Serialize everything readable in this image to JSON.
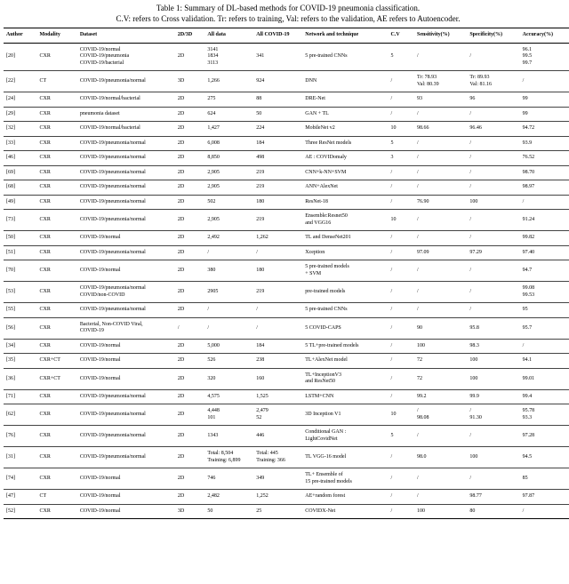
{
  "caption": {
    "line1": "Table 1: Summary of DL-based methods for COVID-19 pneumonia classification.",
    "line2": "C.V: refers to Cross validation. Tr: refers to training, Val: refers to the validation, AE refers to Autoencoder."
  },
  "headers": {
    "author": "Author",
    "modality": "Modality",
    "dataset": "Dataset",
    "dim": "2D/3D",
    "alldata": "All data",
    "allcovid": "All COVID-19",
    "network": "Network and technique",
    "cv": "C.V",
    "sens": "Sensitivity(%)",
    "spec": "Specificity(%)",
    "acc": "Accuracy(%)"
  },
  "rows": [
    {
      "author": "[20]",
      "modality": "CXR",
      "dataset": "COVID-19/normal\nCOVID-19/pneumonia\nCOVID-19/bacterial",
      "dim": "2D",
      "alldata": "3141\n1834\n3113",
      "allcovid": "341",
      "network": "5 pre-trained CNNs",
      "cv": "5",
      "sens": "/",
      "spec": "/",
      "acc": "96.1\n99.5\n99.7"
    },
    {
      "author": "[22]",
      "modality": "CT",
      "dataset": "COVID-19/pneumonia/normal",
      "dim": "3D",
      "alldata": "1,266",
      "allcovid": "924",
      "network": "DNN",
      "cv": "/",
      "sens": "Tr: 78.93\nVal: 80.39",
      "spec": "Tr: 89.93\nVal: 81.16",
      "acc": "/"
    },
    {
      "author": "[24]",
      "modality": "CXR",
      "dataset": "COVID-19/normal/bacterial",
      "dim": "2D",
      "alldata": "275",
      "allcovid": "88",
      "network": "DRE-Net",
      "cv": "/",
      "sens": "93",
      "spec": "96",
      "acc": "99"
    },
    {
      "author": "[29]",
      "modality": "CXR",
      "dataset": "pneumonia dataset",
      "dim": "2D",
      "alldata": "624",
      "allcovid": "50",
      "network": "GAN + TL",
      "cv": "/",
      "sens": "/",
      "spec": "/",
      "acc": "99"
    },
    {
      "author": "[32]",
      "modality": "CXR",
      "dataset": "COVID-19/normal/bacterial",
      "dim": "2D",
      "alldata": "1,427",
      "allcovid": "224",
      "network": "MobileNet v2",
      "cv": "10",
      "sens": "98.66",
      "spec": "96.46",
      "acc": "94.72"
    },
    {
      "author": "[33]",
      "modality": "CXR",
      "dataset": "COVID-19/pneumonia/normal",
      "dim": "2D",
      "alldata": "6,008",
      "allcovid": "184",
      "network": "Three ResNet models",
      "cv": "5",
      "sens": "/",
      "spec": "/",
      "acc": "93.9"
    },
    {
      "author": "[46]",
      "modality": "CXR",
      "dataset": "COVID-19/pneumonia/normal",
      "dim": "2D",
      "alldata": "8,850",
      "allcovid": "498",
      "network": "AE : COVIDomaly",
      "cv": "3",
      "sens": "/",
      "spec": "/",
      "acc": "76.52"
    },
    {
      "author": "[69]",
      "modality": "CXR",
      "dataset": "COVID-19/pneumonia/normal",
      "dim": "2D",
      "alldata": "2,905",
      "allcovid": "219",
      "network": "CNN+k-NN+SVM",
      "cv": "/",
      "sens": "/",
      "spec": "/",
      "acc": "98.70"
    },
    {
      "author": "[68]",
      "modality": "CXR",
      "dataset": "COVID-19/pneumonia/normal",
      "dim": "2D",
      "alldata": "2,905",
      "allcovid": "219",
      "network": "ANN+AlexNet",
      "cv": "/",
      "sens": "/",
      "spec": "/",
      "acc": "98.97"
    },
    {
      "author": "[49]",
      "modality": "CXR",
      "dataset": "COVID-19/pneumonia/normal",
      "dim": "2D",
      "alldata": "502",
      "allcovid": "180",
      "network": "ResNet-18",
      "cv": "/",
      "sens": "76.90",
      "spec": "100",
      "acc": "/"
    },
    {
      "author": "[73]",
      "modality": "CXR",
      "dataset": "COVID-19/pneumonia/normal",
      "dim": "2D",
      "alldata": "2,905",
      "allcovid": "219",
      "network": "Ensemble:Resnet50\nand VGG16",
      "cv": "10",
      "sens": "/",
      "spec": "/",
      "acc": "91.24"
    },
    {
      "author": "[50]",
      "modality": "CXR",
      "dataset": "COVID-19/normal",
      "dim": "2D",
      "alldata": "2,492",
      "allcovid": "1,262",
      "network": "TL and DenseNet201",
      "cv": "/",
      "sens": "/",
      "spec": "/",
      "acc": "99.82"
    },
    {
      "author": "[51]",
      "modality": "CXR",
      "dataset": "COVID-19/pneumonia/normal",
      "dim": "2D",
      "alldata": "/",
      "allcovid": "/",
      "network": "Xception",
      "cv": "/",
      "sens": "97.09",
      "spec": "97.29",
      "acc": "97.40"
    },
    {
      "author": "[70]",
      "modality": "CXR",
      "dataset": "COVID-19/normal",
      "dim": "2D",
      "alldata": "380",
      "allcovid": "180",
      "network": "5 pre-trained models\n+ SVM",
      "cv": "/",
      "sens": "/",
      "spec": "/",
      "acc": "94.7"
    },
    {
      "author": "[53]",
      "modality": "CXR",
      "dataset": "COVID-19/pneumonia/normal\nCOVID/non-COVID",
      "dim": "2D",
      "alldata": "2905",
      "allcovid": "219",
      "network": "pre-trained models",
      "cv": "/",
      "sens": "/",
      "spec": "/",
      "acc": "99.08\n99.53"
    },
    {
      "author": "[55]",
      "modality": "CXR",
      "dataset": "COVID-19/pneumonia/normal",
      "dim": "2D",
      "alldata": "/",
      "allcovid": "/",
      "network": "5 pre-trained CNNs",
      "cv": "/",
      "sens": "/",
      "spec": "/",
      "acc": "95"
    },
    {
      "author": "[56]",
      "modality": "CXR",
      "dataset": "Bacterial, Non-COVID Viral,\nCOVID-19",
      "dim": "/",
      "alldata": "/",
      "allcovid": "/",
      "network": "5 COVID-CAPS",
      "cv": "/",
      "sens": "90",
      "spec": "95.8",
      "acc": "95.7"
    },
    {
      "author": "[34]",
      "modality": "CXR",
      "dataset": "COVID-19/normal",
      "dim": "2D",
      "alldata": "5,000",
      "allcovid": "184",
      "network": "5 TL+pre-trained models",
      "cv": "/",
      "sens": "100",
      "spec": "98.3",
      "acc": "/"
    },
    {
      "author": "[35]",
      "modality": "CXR+CT",
      "dataset": "COVID-19/normal",
      "dim": "2D",
      "alldata": "526",
      "allcovid": "238",
      "network": "TL+AlexNet model",
      "cv": "/",
      "sens": "72",
      "spec": "100",
      "acc": "94.1"
    },
    {
      "author": "[36]",
      "modality": "CXR+CT",
      "dataset": "COVID-19/normal",
      "dim": "2D",
      "alldata": "320",
      "allcovid": "160",
      "network": "TL+InceptionV3\nand ResNet50",
      "cv": "/",
      "sens": "72",
      "spec": "100",
      "acc": "99.01"
    },
    {
      "author": "[71]",
      "modality": "CXR",
      "dataset": "COVID-19/pneumonia/normal",
      "dim": "2D",
      "alldata": "4,575",
      "allcovid": "1,525",
      "network": "LSTM+CNN",
      "cv": "/",
      "sens": "99.2",
      "spec": "99.9",
      "acc": "99.4"
    },
    {
      "author": "[62]",
      "modality": "CXR",
      "dataset": "COVID-19/pneumonia/normal",
      "dim": "2D",
      "alldata": "4,448\n101",
      "allcovid": "2,479\n52",
      "network": "3D Inception V1",
      "cv": "10",
      "sens": "/\n98.08",
      "spec": "/\n91.30",
      "acc": "95.78\n93.3"
    },
    {
      "author": "[76]",
      "modality": "CXR",
      "dataset": "COVID-19/pneumonia/normal",
      "dim": "2D",
      "alldata": "1343",
      "allcovid": "446",
      "network": "Conditional GAN :\nLightCovidNet",
      "cv": "5",
      "sens": "/",
      "spec": "/",
      "acc": "97.28"
    },
    {
      "author": "[31]",
      "modality": "CXR",
      "dataset": "COVID-19/pneumonia/normal",
      "dim": "2D",
      "alldata": "Total: 8,504\nTraining: 6,899",
      "allcovid": "Total: 445\nTraining: 366",
      "network": "TL VGG-16 model",
      "cv": "/",
      "sens": "98.0",
      "spec": "100",
      "acc": "94.5"
    },
    {
      "author": "[74]",
      "modality": "CXR",
      "dataset": "COVID-19/normal",
      "dim": "2D",
      "alldata": "746",
      "allcovid": "349",
      "network": "TL+ Ensemble of\n15 pre-trained models",
      "cv": "/",
      "sens": "/",
      "spec": "/",
      "acc": "85"
    },
    {
      "author": "[47]",
      "modality": "CT",
      "dataset": "COVID-19/normal",
      "dim": "2D",
      "alldata": "2,482",
      "allcovid": "1,252",
      "network": "AE+random forest",
      "cv": "/",
      "sens": "/",
      "spec": "98.77",
      "acc": "97.87"
    },
    {
      "author": "[52]",
      "modality": "CXR",
      "dataset": "COVID-19/normal",
      "dim": "3D",
      "alldata": "50",
      "allcovid": "25",
      "network": "COVIDX-Net",
      "cv": "/",
      "sens": "100",
      "spec": "80",
      "acc": "/"
    }
  ]
}
